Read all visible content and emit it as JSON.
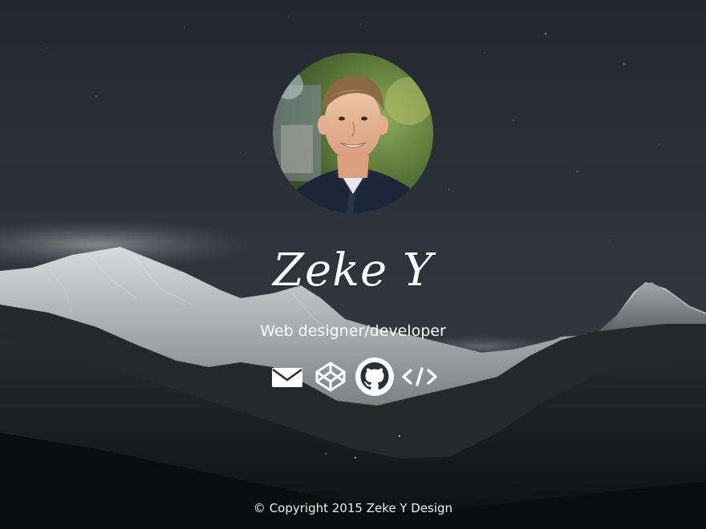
{
  "profile": {
    "name": "Zeke Y",
    "tagline": "Web designer/developer",
    "avatar_icon": "profile-photo"
  },
  "social": [
    {
      "id": "email",
      "icon": "email-icon"
    },
    {
      "id": "codepen",
      "icon": "codepen-icon"
    },
    {
      "id": "github",
      "icon": "github-icon"
    },
    {
      "id": "code",
      "icon": "code-icon"
    }
  ],
  "footer": {
    "copyright": "© Copyright 2015 Zeke Y Design"
  },
  "colors": {
    "sky": "#2a2f37",
    "foreground": "#ffffff",
    "snow": "#cfd2d4",
    "mountain_dark": "#1a1b1c"
  }
}
